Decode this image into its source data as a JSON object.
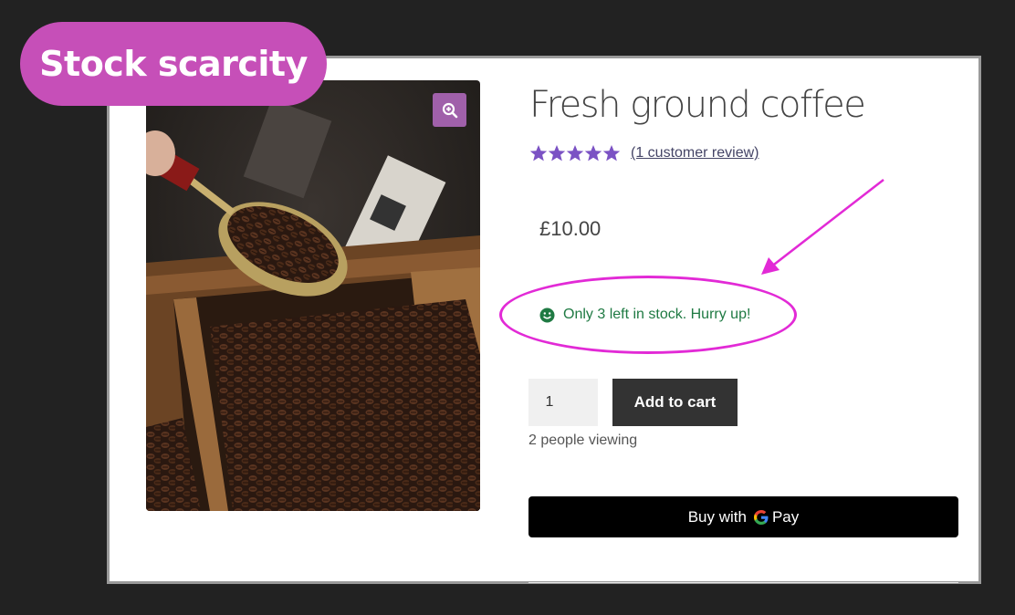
{
  "badge": {
    "label": "Stock scarcity"
  },
  "product": {
    "title": "Fresh ground coffee",
    "rating": 5,
    "review_link": "(1 customer review)",
    "price": "£10.00",
    "stock_message": "Only 3 left in stock. Hurry up!",
    "quantity": "1",
    "viewing": "2 people viewing"
  },
  "actions": {
    "add_to_cart": "Add to cart",
    "buy_with": "Buy with",
    "pay": "Pay"
  },
  "colors": {
    "badge": "#c64fb8",
    "star": "#7b52c4",
    "stock_text": "#1f7a43",
    "highlight": "#e22ad6",
    "button_dark": "#333333"
  }
}
